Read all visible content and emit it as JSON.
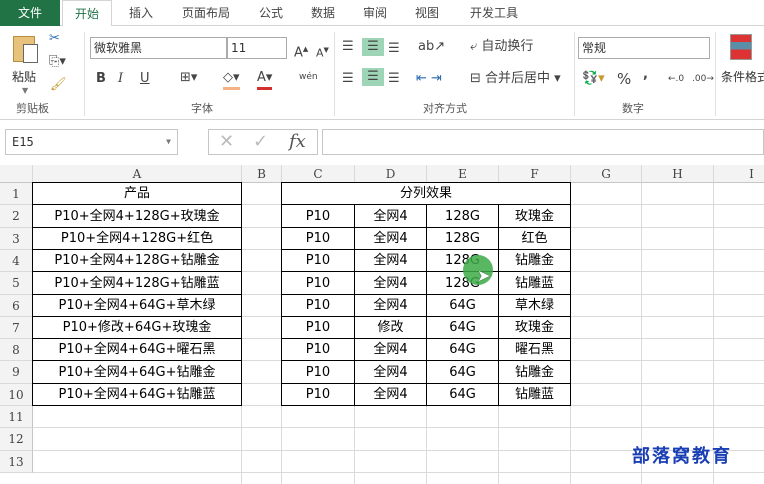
{
  "tabs": [
    "文件",
    "开始",
    "插入",
    "页面布局",
    "公式",
    "数据",
    "审阅",
    "视图",
    "开发工具"
  ],
  "ribbon": {
    "paste": "粘贴",
    "clipboard_group": "剪贴板",
    "font_name": "微软雅黑",
    "font_size": "11",
    "font_group": "字体",
    "bold": "B",
    "italic": "I",
    "underline": "U",
    "phonetic": "wén",
    "wrap_text": "自动换行",
    "merge_center": "合并后居中",
    "align_group": "对齐方式",
    "number_format": "常规",
    "percent": "%",
    "comma": ",",
    "number_group": "数字",
    "conditional_format": "条件格式"
  },
  "formula_bar": {
    "name_box": "E15",
    "fx": "fx",
    "value": ""
  },
  "columns": [
    "A",
    "B",
    "C",
    "D",
    "E",
    "F",
    "G",
    "H",
    "I"
  ],
  "rows": [
    "1",
    "2",
    "3",
    "4",
    "5",
    "6",
    "7",
    "8",
    "9",
    "10",
    "11",
    "12",
    "13"
  ],
  "table_a": {
    "header": "产品",
    "items": [
      "P10+全网4+128G+玫瑰金",
      "P10+全网4+128G+红色",
      "P10+全网4+128G+钻雕金",
      "P10+全网4+128G+钻雕蓝",
      "P10+全网4+64G+草木绿",
      "P10+修改+64G+玫瑰金",
      "P10+全网4+64G+曜石黑",
      "P10+全网4+64G+钻雕金",
      "P10+全网4+64G+钻雕蓝"
    ]
  },
  "table_split": {
    "header": "分列效果",
    "rows": [
      [
        "P10",
        "全网4",
        "128G",
        "玫瑰金"
      ],
      [
        "P10",
        "全网4",
        "128G",
        "红色"
      ],
      [
        "P10",
        "全网4",
        "128G",
        "钻雕金"
      ],
      [
        "P10",
        "全网4",
        "128G",
        "钻雕蓝"
      ],
      [
        "P10",
        "全网4",
        "64G",
        "草木绿"
      ],
      [
        "P10",
        "修改",
        "64G",
        "玫瑰金"
      ],
      [
        "P10",
        "全网4",
        "64G",
        "曜石黑"
      ],
      [
        "P10",
        "全网4",
        "64G",
        "钻雕金"
      ],
      [
        "P10",
        "全网4",
        "64G",
        "钻雕蓝"
      ]
    ]
  },
  "watermark": "部落窝教育",
  "colors": {
    "accent": "#217346",
    "watermark": "#1a3fb5"
  }
}
